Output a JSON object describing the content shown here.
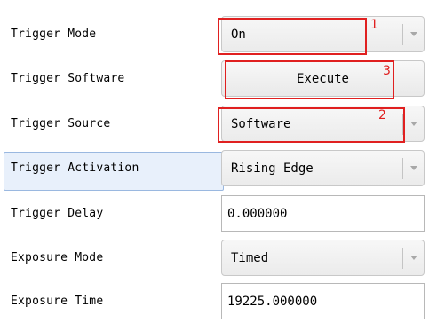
{
  "properties": [
    {
      "label": "Trigger Mode",
      "value": "On",
      "type": "combo"
    },
    {
      "label": "Trigger Software",
      "value": "Execute",
      "type": "button"
    },
    {
      "label": "Trigger Source",
      "value": "Software",
      "type": "combo"
    },
    {
      "label": "Trigger Activation",
      "value": "Rising Edge",
      "type": "combo",
      "selected": true
    },
    {
      "label": "Trigger Delay",
      "value": "0.000000",
      "type": "text"
    },
    {
      "label": "Exposure Mode",
      "value": "Timed",
      "type": "combo"
    },
    {
      "label": "Exposure Time",
      "value": "19225.000000",
      "type": "text"
    }
  ],
  "annotations": {
    "marker_1": "1",
    "marker_2": "2",
    "marker_3": "3",
    "color": "#e02020"
  },
  "icons": {
    "dropdown": "chevron-down-icon"
  }
}
